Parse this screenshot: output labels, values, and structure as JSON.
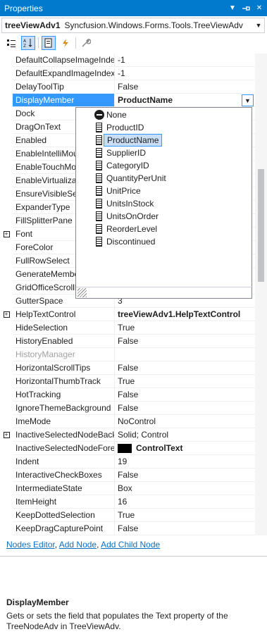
{
  "window": {
    "title": "Properties",
    "pin_glyph": "↓",
    "menu_glyph": "▼",
    "close_glyph": "✕"
  },
  "object": {
    "name": "treeViewAdv1",
    "type": "Syncfusion.Windows.Forms.Tools.TreeViewAdv"
  },
  "colors": {
    "title_bar": "#007acc",
    "selection": "#3399ff",
    "link": "#0e70c0"
  },
  "toolbar": {
    "buttons": [
      {
        "icon": "categorized-icon"
      },
      {
        "icon": "alphabetical-icon",
        "active": true
      },
      {
        "icon": "properties-icon",
        "active": true
      },
      {
        "icon": "events-icon"
      },
      {
        "icon": "property-pages-icon"
      }
    ]
  },
  "properties": [
    {
      "name": "DefaultCollapseImageIndex",
      "value": "-1"
    },
    {
      "name": "DefaultExpandImageIndex",
      "value": "-1"
    },
    {
      "name": "DelayToolTip",
      "value": "False"
    },
    {
      "name": "DisplayMember",
      "value": "ProductName",
      "selected": true,
      "bold": true
    },
    {
      "name": "Dock",
      "value": ""
    },
    {
      "name": "DragOnText",
      "value": ""
    },
    {
      "name": "Enabled",
      "value": ""
    },
    {
      "name": "EnableIntelliMouse",
      "value": ""
    },
    {
      "name": "EnableTouchMode",
      "value": ""
    },
    {
      "name": "EnableVirtualization",
      "value": ""
    },
    {
      "name": "EnsureVisibleSelection",
      "value": ""
    },
    {
      "name": "ExpanderType",
      "value": ""
    },
    {
      "name": "FillSplitterPane",
      "value": ""
    },
    {
      "name": "Font",
      "value": "",
      "expandable": true
    },
    {
      "name": "ForeColor",
      "value": ""
    },
    {
      "name": "FullRowSelect",
      "value": ""
    },
    {
      "name": "GenerateMember",
      "value": ""
    },
    {
      "name": "GridOfficeScrollBars",
      "value": ""
    },
    {
      "name": "GutterSpace",
      "value": "3"
    },
    {
      "name": "HelpTextControl",
      "value": "treeViewAdv1.HelpTextControl",
      "bold": true,
      "expandable": true
    },
    {
      "name": "HideSelection",
      "value": "True"
    },
    {
      "name": "HistoryEnabled",
      "value": "False"
    },
    {
      "name": "HistoryManager",
      "value": "",
      "muted": true
    },
    {
      "name": "HorizontalScrollTips",
      "value": "False"
    },
    {
      "name": "HorizontalThumbTrack",
      "value": "True"
    },
    {
      "name": "HotTracking",
      "value": "False"
    },
    {
      "name": "IgnoreThemeBackground",
      "value": "False"
    },
    {
      "name": "ImeMode",
      "value": "NoControl"
    },
    {
      "name": "InactiveSelectedNodeBackground",
      "value": "Solid; Control",
      "expandable": true
    },
    {
      "name": "InactiveSelectedNodeForeColor",
      "value": "ControlText",
      "bold": true,
      "swatch": "#000000"
    },
    {
      "name": "Indent",
      "value": "19"
    },
    {
      "name": "InteractiveCheckBoxes",
      "value": "False"
    },
    {
      "name": "IntermediateState",
      "value": "Box"
    },
    {
      "name": "ItemHeight",
      "value": "16"
    },
    {
      "name": "KeepDottedSelection",
      "value": "True"
    },
    {
      "name": "KeepDragCapturePoint",
      "value": "False"
    }
  ],
  "dropdown": {
    "items": [
      {
        "label": "None",
        "icon": "none-icon"
      },
      {
        "label": "ProductID",
        "icon": "field-icon"
      },
      {
        "label": "ProductName",
        "icon": "field-icon",
        "selected": true
      },
      {
        "label": "SupplierID",
        "icon": "field-icon"
      },
      {
        "label": "CategoryID",
        "icon": "field-icon"
      },
      {
        "label": "QuantityPerUnit",
        "icon": "field-icon"
      },
      {
        "label": "UnitPrice",
        "icon": "field-icon"
      },
      {
        "label": "UnitsInStock",
        "icon": "field-icon"
      },
      {
        "label": "UnitsOnOrder",
        "icon": "field-icon"
      },
      {
        "label": "ReorderLevel",
        "icon": "field-icon"
      },
      {
        "label": "Discontinued",
        "icon": "field-icon"
      }
    ]
  },
  "commands": {
    "nodes_editor": "Nodes Editor",
    "add_node": "Add Node",
    "add_child_node": "Add Child Node",
    "separator": ", "
  },
  "description": {
    "title": "DisplayMember",
    "text": "Gets or sets the field that populates the Text property of the TreeNodeAdv in TreeViewAdv."
  }
}
